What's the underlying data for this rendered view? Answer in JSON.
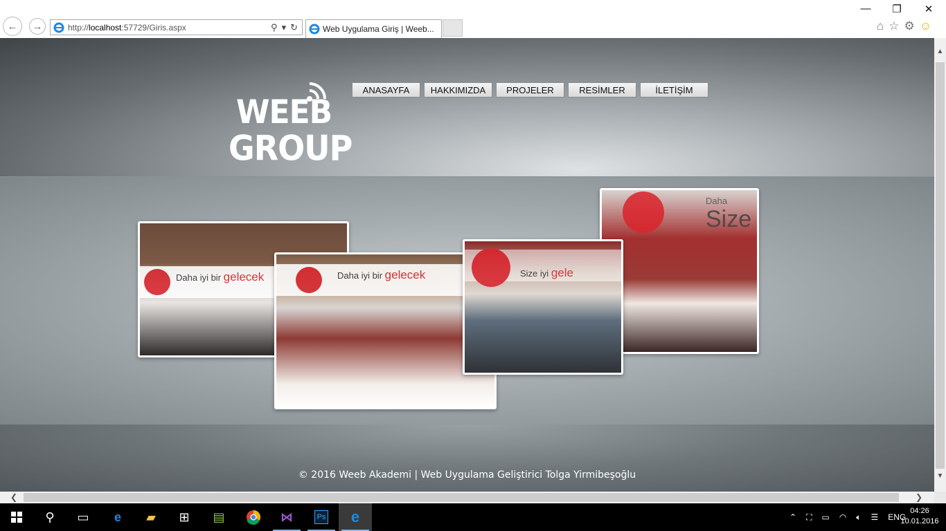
{
  "browser": {
    "url_prefix": "http://",
    "url_host": "localhost",
    "url_rest": ":57729/Giris.aspx",
    "tab_title": "Web Uygulama Giriş | Weeb...",
    "win_min": "—",
    "win_max": "❐",
    "win_close": "✕"
  },
  "site": {
    "logo_line1": "WEEB",
    "logo_line2": "GROUP",
    "menu": [
      {
        "label": "ANASAYFA"
      },
      {
        "label": "HAKKIMIZDA"
      },
      {
        "label": "PROJELER"
      },
      {
        "label": "RESİMLER"
      },
      {
        "label": "İLETİŞİM"
      }
    ],
    "gallery": [
      {
        "banner_a": "Daha iyi bir",
        "banner_b": "gelecek"
      },
      {
        "banner_a": "Daha iyi bir",
        "banner_b": "gelecek"
      },
      {
        "banner_a": "Size iyi",
        "banner_b": "gele"
      },
      {
        "banner_a": "Daha",
        "banner_b": "Size"
      }
    ],
    "footer": "© 2016 Weeb Akademi | Web Uygulama Geliştirici Tolga Yirmibeşoğlu"
  },
  "taskbar": {
    "lang": "ENG",
    "time": "04:26",
    "date": "10.01.2016"
  },
  "colors": {
    "accent_red": "#d9262e",
    "ie_blue": "#1e88e5"
  }
}
